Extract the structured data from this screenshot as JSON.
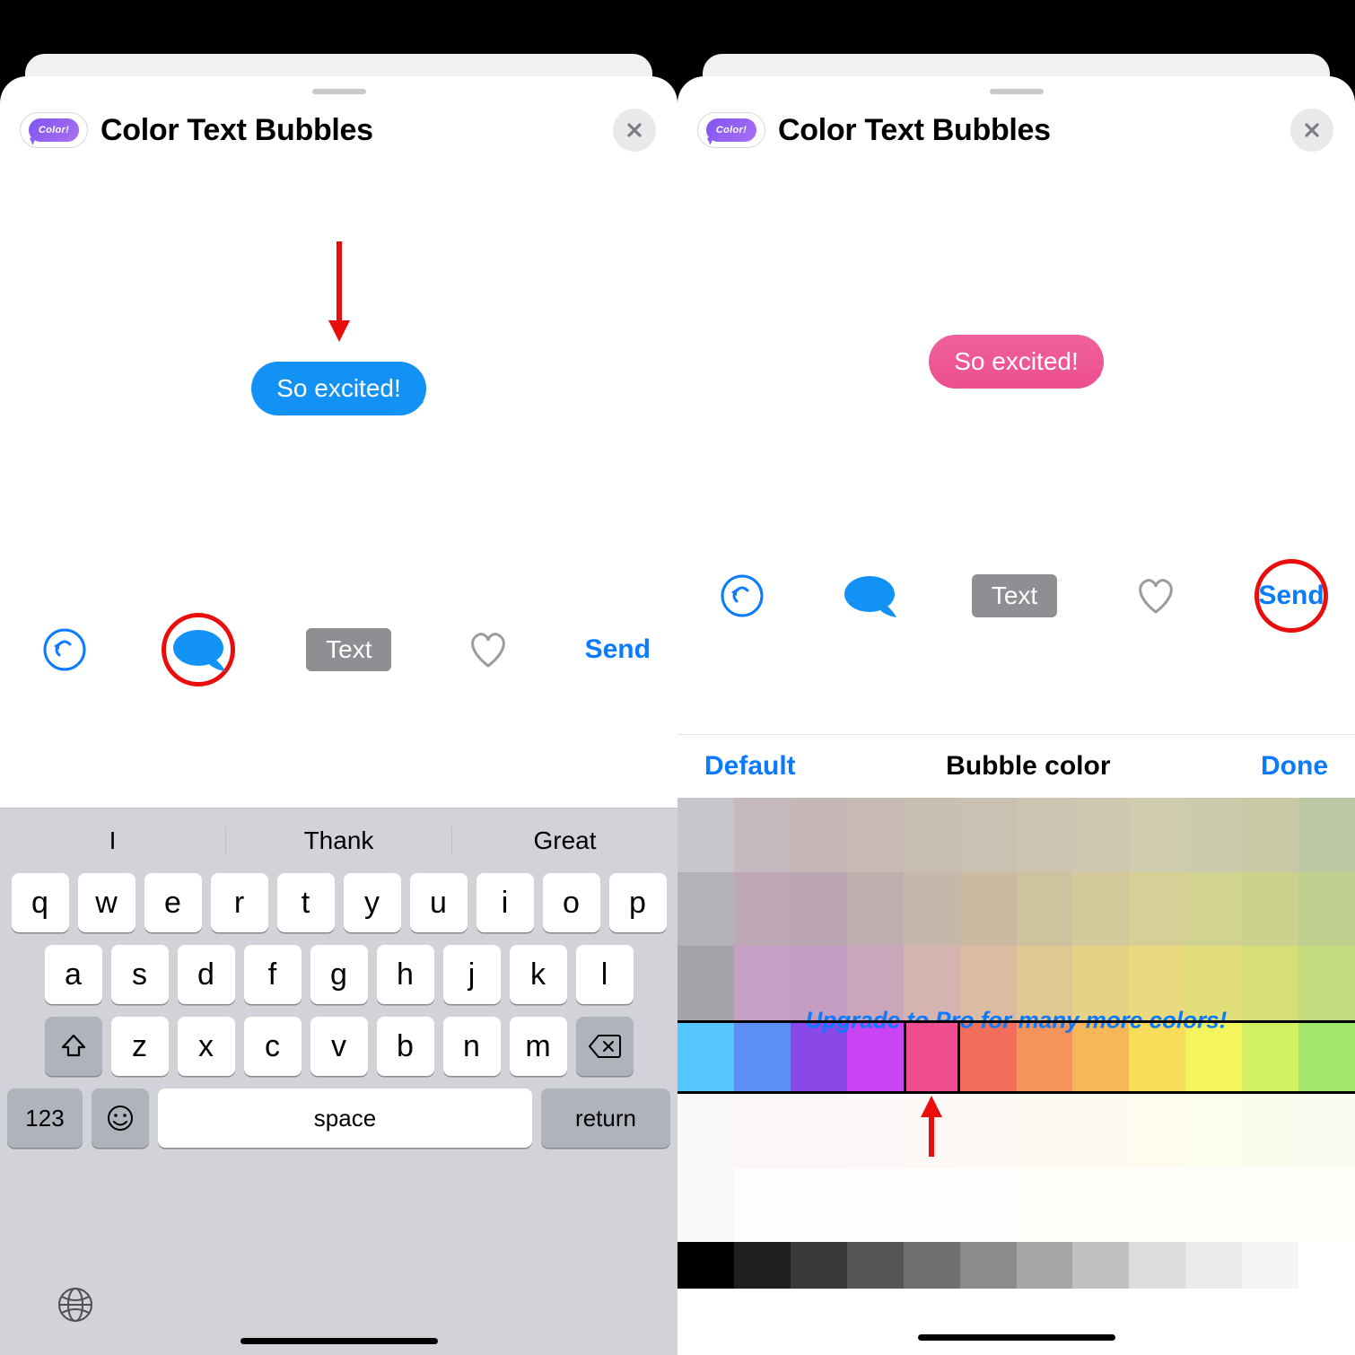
{
  "app": {
    "title": "Color Text Bubbles",
    "badge_label": "Color!"
  },
  "preview": {
    "message_text": "So excited!"
  },
  "toolbar": {
    "text_button_label": "Text",
    "send_label": "Send"
  },
  "keyboard": {
    "suggestions": [
      "I",
      "Thank",
      "Great"
    ],
    "row1": [
      "q",
      "w",
      "e",
      "r",
      "t",
      "y",
      "u",
      "i",
      "o",
      "p"
    ],
    "row2": [
      "a",
      "s",
      "d",
      "f",
      "g",
      "h",
      "j",
      "k",
      "l"
    ],
    "row3": [
      "z",
      "x",
      "c",
      "v",
      "b",
      "n",
      "m"
    ],
    "fn": {
      "numbers": "123",
      "space": "space",
      "ret": "return"
    }
  },
  "picker": {
    "left_link": "Default",
    "title": "Bubble color",
    "right_link": "Done",
    "upgrade_text": "Upgrade to Pro for many more colors!",
    "selected_row_index": 3,
    "selected_col_index": 4,
    "rows": [
      [
        "#c6c6cb",
        "#c6babf",
        "#c5b7b6",
        "#c7bab4",
        "#c9beb2",
        "#cbc1b3",
        "#cdc5b2",
        "#cdc8af",
        "#cfccaf",
        "#cbccab",
        "#c7c9a5",
        "#bec7a4"
      ],
      [
        "#b2b3b8",
        "#bea8b5",
        "#bba5b1",
        "#c0aeaf",
        "#c6b7aa",
        "#cabaa2",
        "#cfc29f",
        "#d4c99a",
        "#d7d096",
        "#d2d291",
        "#cbd28e",
        "#bfcf8e"
      ],
      [
        "#a3a4aa",
        "#c6a0c4",
        "#c49dc3",
        "#cba6bb",
        "#d4b3b0",
        "#dbbca0",
        "#e1c791",
        "#e6d286",
        "#ead97e",
        "#e2de79",
        "#d5de78",
        "#c3da7d"
      ],
      [
        "#55c7fe",
        "#5d8ef6",
        "#8b48e8",
        "#c945f3",
        "#ee4e8e",
        "#f26f5c",
        "#f4935b",
        "#f6b75a",
        "#f8dd5b",
        "#f4f45e",
        "#d1f063",
        "#a3e76d"
      ],
      [
        "#f8f8f9",
        "#fbf7f9",
        "#fbf6f9",
        "#fcf7f8",
        "#fdf8f6",
        "#fdf9f4",
        "#fdfaf2",
        "#fdfbf0",
        "#fdfcef",
        "#fcfdee",
        "#fafded",
        "#f8fdef"
      ],
      [
        "#f8f8f9",
        "#fefdfe",
        "#fefdfe",
        "#fefdfe",
        "#fefefd",
        "#fefefc",
        "#fefefb",
        "#fefefa",
        "#fefefa",
        "#fdfefa",
        "#fdfef9",
        "#fcfefa"
      ]
    ],
    "bw_row": [
      "#000000",
      "#1f1f1f",
      "#3a3a3a",
      "#555555",
      "#707070",
      "#8b8b8b",
      "#a6a6a6",
      "#c1c1c1",
      "#dcdcdc",
      "#ebebeb",
      "#f5f5f5",
      "#ffffff"
    ]
  }
}
